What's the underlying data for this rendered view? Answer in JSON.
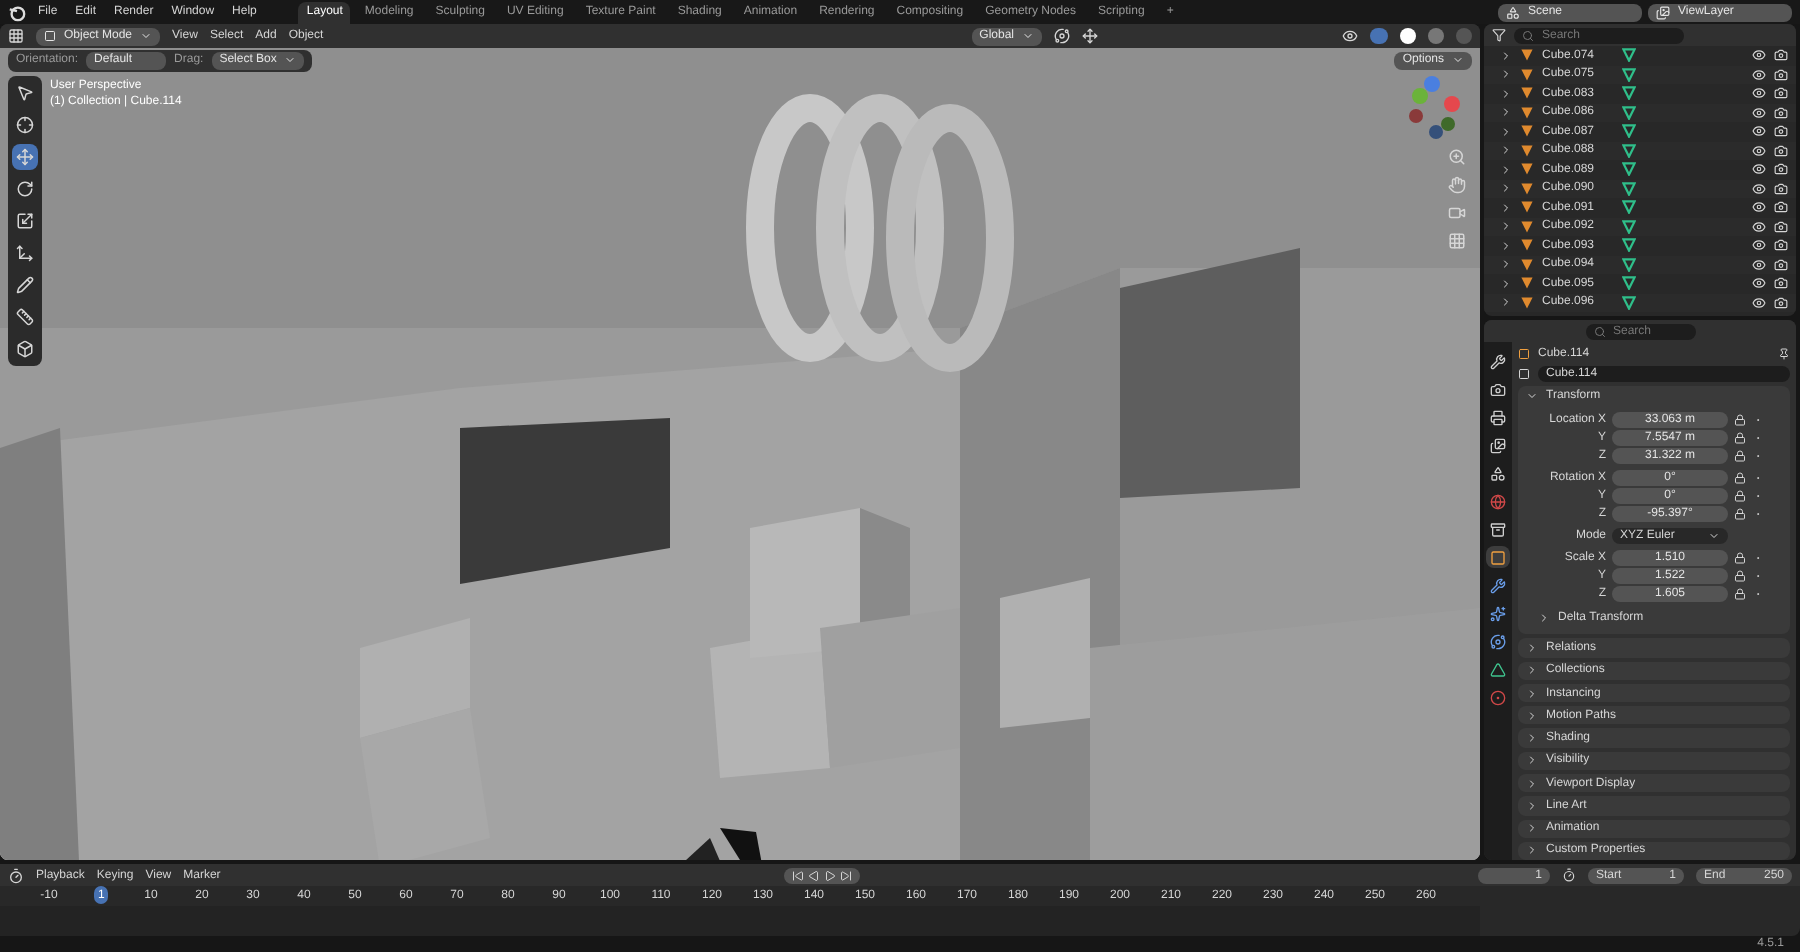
{
  "menu": [
    "File",
    "Edit",
    "Render",
    "Window",
    "Help"
  ],
  "workspaces": [
    {
      "label": "Layout",
      "selected": true
    },
    {
      "label": "Modeling",
      "selected": false
    },
    {
      "label": "Sculpting",
      "selected": false
    },
    {
      "label": "UV Editing",
      "selected": false
    },
    {
      "label": "Texture Paint",
      "selected": false
    },
    {
      "label": "Shading",
      "selected": false
    },
    {
      "label": "Animation",
      "selected": false
    },
    {
      "label": "Rendering",
      "selected": false
    },
    {
      "label": "Compositing",
      "selected": false
    },
    {
      "label": "Geometry Nodes",
      "selected": false
    },
    {
      "label": "Scripting",
      "selected": false
    },
    {
      "label": "+",
      "selected": false
    }
  ],
  "scene": "Scene",
  "view_layer": "ViewLayer",
  "viewport": {
    "mode": "Object Mode",
    "menus": [
      "View",
      "Select",
      "Add",
      "Object"
    ],
    "orientation": "Global",
    "options": "Options",
    "tool_settings": {
      "orientation_label": "Orientation:",
      "orientation": "Default",
      "drag_label": "Drag:",
      "drag": "Select Box"
    },
    "overlay_text": [
      "User Perspective",
      "(1) Collection | Cube.114"
    ],
    "tools": [
      {
        "kind": "select",
        "selected": false
      },
      {
        "kind": "cursor",
        "selected": false
      },
      {
        "kind": "move",
        "selected": true
      },
      {
        "kind": "rotate",
        "selected": false
      },
      {
        "kind": "scale",
        "selected": false
      },
      {
        "kind": "transform",
        "selected": false
      },
      {
        "kind": "annotate",
        "selected": false
      },
      {
        "kind": "measure",
        "selected": false
      },
      {
        "kind": "add_cube",
        "selected": false
      }
    ]
  },
  "outliner": {
    "search": {
      "placeholder": "Search"
    },
    "items": [
      "Cube.074",
      "Cube.075",
      "Cube.083",
      "Cube.086",
      "Cube.087",
      "Cube.088",
      "Cube.089",
      "Cube.090",
      "Cube.091",
      "Cube.092",
      "Cube.093",
      "Cube.094",
      "Cube.095",
      "Cube.096"
    ]
  },
  "properties": {
    "search": {
      "placeholder": "Search"
    },
    "object": "Cube.114",
    "datablock": "Cube.114",
    "tabs": [
      {
        "kind": "tool",
        "selected": false
      },
      {
        "kind": "render",
        "selected": false
      },
      {
        "kind": "output",
        "selected": false
      },
      {
        "kind": "view_layer",
        "selected": false
      },
      {
        "kind": "scene",
        "selected": false
      },
      {
        "kind": "world",
        "selected": false
      },
      {
        "kind": "collection",
        "selected": false
      },
      {
        "kind": "object",
        "selected": true
      },
      {
        "kind": "modifiers",
        "selected": false
      },
      {
        "kind": "particles",
        "selected": false
      },
      {
        "kind": "physics",
        "selected": false
      },
      {
        "kind": "data",
        "selected": false
      },
      {
        "kind": "material",
        "selected": false
      }
    ],
    "transform": {
      "title": "Transform",
      "groups": [
        {
          "rows": [
            {
              "label": "Location X",
              "value": "33.063 m"
            },
            {
              "label": "Y",
              "value": "7.5547 m"
            },
            {
              "label": "Z",
              "value": "31.322 m"
            }
          ]
        },
        {
          "rows": [
            {
              "label": "Rotation X",
              "value": "0°"
            },
            {
              "label": "Y",
              "value": "0°"
            },
            {
              "label": "Z",
              "value": "-95.397°"
            }
          ]
        },
        {
          "mode_label": "Mode",
          "mode": "XYZ Euler"
        },
        {
          "rows": [
            {
              "label": "Scale X",
              "value": "1.510"
            },
            {
              "label": "Y",
              "value": "1.522"
            },
            {
              "label": "Z",
              "value": "1.605"
            }
          ]
        }
      ],
      "subpanel": "Delta Transform"
    },
    "panels": [
      "Relations",
      "Collections",
      "Instancing",
      "Motion Paths",
      "Shading",
      "Visibility",
      "Viewport Display",
      "Line Art",
      "Animation",
      "Custom Properties"
    ]
  },
  "timeline": {
    "menus": [
      "Playback",
      "Keying",
      "View",
      "Marker"
    ],
    "current_frame": "1",
    "start_label": "Start",
    "start": "1",
    "end_label": "End",
    "end": "250",
    "playhead": "1",
    "ticks": [
      "-10",
      "10",
      "20",
      "30",
      "40",
      "50",
      "60",
      "70",
      "80",
      "90",
      "100",
      "110",
      "120",
      "130",
      "140",
      "150",
      "160",
      "170",
      "180",
      "190",
      "200",
      "210",
      "220",
      "230",
      "240",
      "250",
      "260"
    ]
  },
  "status": {
    "version": "4.5.1"
  }
}
